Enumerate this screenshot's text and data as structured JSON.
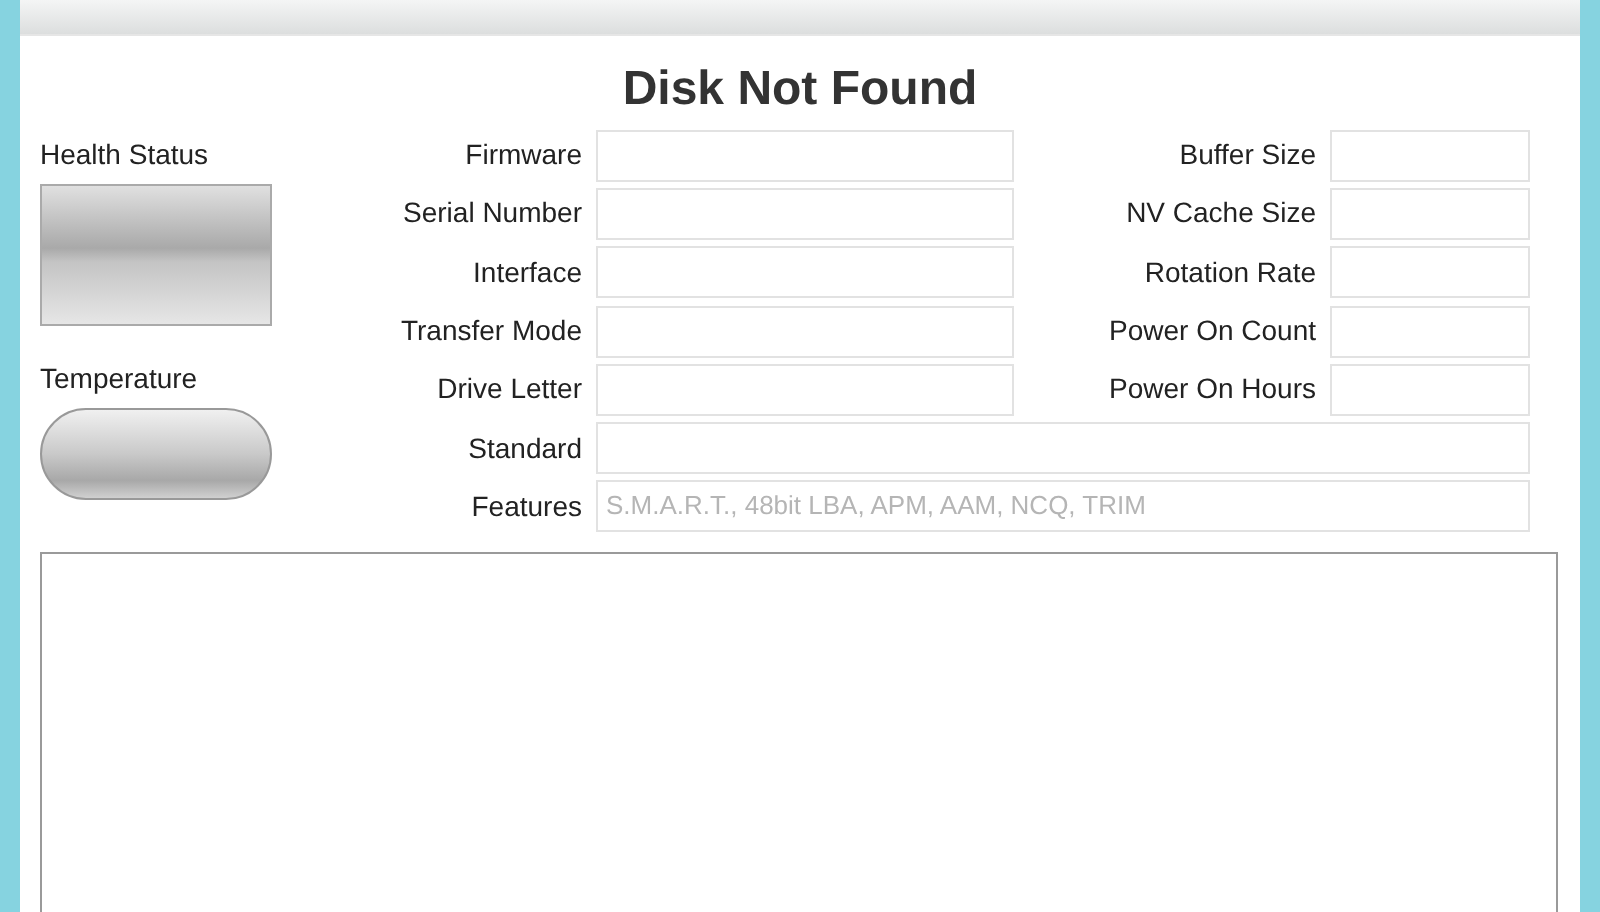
{
  "title": "Disk Not Found",
  "health": {
    "label": "Health Status"
  },
  "temperature": {
    "label": "Temperature"
  },
  "left_fields": [
    {
      "label": "Firmware"
    },
    {
      "label": "Serial Number"
    },
    {
      "label": "Interface"
    },
    {
      "label": "Transfer Mode"
    },
    {
      "label": "Drive Letter"
    }
  ],
  "right_fields": [
    {
      "label": "Buffer Size"
    },
    {
      "label": "NV Cache Size"
    },
    {
      "label": "Rotation Rate"
    },
    {
      "label": "Power On Count"
    },
    {
      "label": "Power On Hours"
    }
  ],
  "standard": {
    "label": "Standard"
  },
  "features": {
    "label": "Features",
    "value": "S.M.A.R.T., 48bit LBA, APM, AAM, NCQ, TRIM",
    "disabled": true
  }
}
